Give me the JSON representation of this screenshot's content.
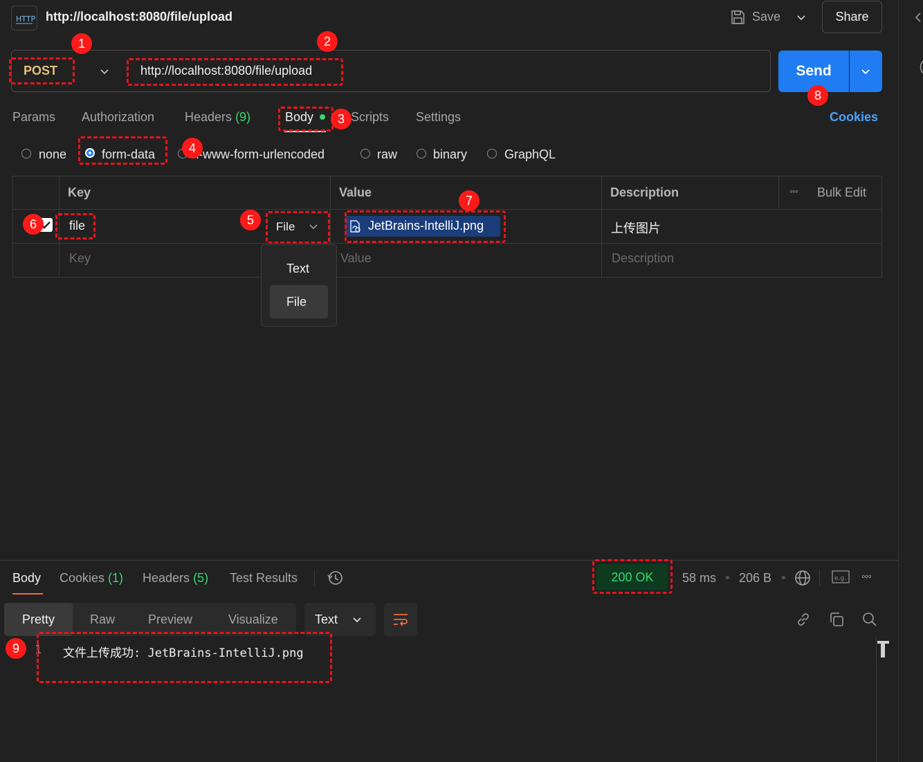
{
  "header": {
    "title": "http://localhost:8080/file/upload",
    "save_label": "Save",
    "share_label": "Share"
  },
  "request": {
    "method": "POST",
    "url": "http://localhost:8080/file/upload",
    "send_label": "Send"
  },
  "tabs": [
    {
      "label": "Params"
    },
    {
      "label": "Authorization"
    },
    {
      "label": "Headers",
      "count": "(9)"
    },
    {
      "label": "Body"
    },
    {
      "label": "Scripts"
    },
    {
      "label": "Settings"
    }
  ],
  "cookies_link": "Cookies",
  "body_types": [
    "none",
    "form-data",
    "x-www-form-urlencoded",
    "raw",
    "binary",
    "GraphQL"
  ],
  "body_type_selected": "form-data",
  "table": {
    "headers": {
      "key": "Key",
      "value": "Value",
      "description": "Description",
      "bulk_edit": "Bulk Edit"
    },
    "row": {
      "key": "file",
      "type": "File",
      "value": "JetBrains-IntelliJ.png",
      "description": "上传图片"
    },
    "placeholders": {
      "key": "Key",
      "value": "Value",
      "description": "Description"
    }
  },
  "type_dropdown": {
    "options": [
      "Text",
      "File"
    ],
    "selected": "File"
  },
  "response": {
    "tabs": [
      {
        "label": "Body"
      },
      {
        "label": "Cookies",
        "count": "(1)"
      },
      {
        "label": "Headers",
        "count": "(5)"
      },
      {
        "label": "Test Results"
      }
    ],
    "status": "200 OK",
    "time": "58 ms",
    "size": "206 B",
    "view_modes": [
      "Pretty",
      "Raw",
      "Preview",
      "Visualize"
    ],
    "format": "Text",
    "line_number": "1",
    "body_text": "文件上传成功: JetBrains-IntelliJ.png"
  },
  "annotations": [
    "1",
    "2",
    "3",
    "4",
    "5",
    "6",
    "7",
    "8",
    "9"
  ],
  "colors": {
    "accent": "#1f7cf3",
    "method": "#e5c07b",
    "annotation": "#e8141b",
    "status_bg": "#0e3a1f"
  }
}
